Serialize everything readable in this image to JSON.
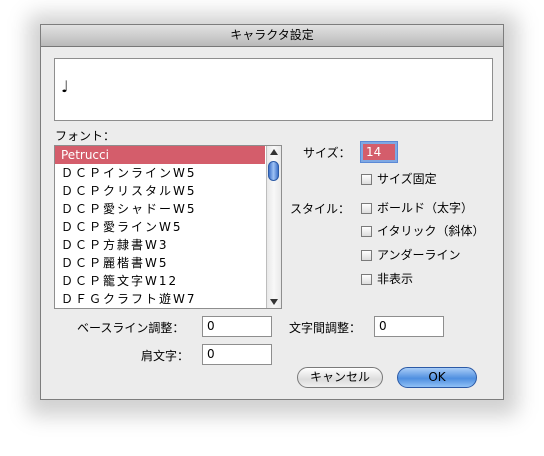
{
  "dialog": {
    "title": "キャラクタ設定",
    "preview_text": "♩"
  },
  "font_section": {
    "label": "フォント：",
    "items": [
      "Petrucci",
      "ＤＣＰインラインW5",
      "ＤＣＰクリスタルW5",
      "ＤＣＰ愛シャドーW5",
      "ＤＣＰ愛ラインW5",
      "ＤＣＰ方隷書W3",
      "ＤＣＰ麗楷書W5",
      "ＤＣＰ籠文字W12",
      "ＤＦＧクラフト遊W7"
    ],
    "selected_index": 0
  },
  "size": {
    "label": "サイズ：",
    "value": "14",
    "fixed_label": "サイズ固定"
  },
  "style": {
    "label": "スタイル：",
    "options": [
      "ボールド（太字）",
      "イタリック（斜体）",
      "アンダーライン",
      "非表示"
    ]
  },
  "fields": {
    "baseline_label": "ベースライン調整：",
    "baseline_value": "0",
    "tracking_label": "文字間調整：",
    "tracking_value": "0",
    "superscript_label": "肩文字：",
    "superscript_value": "0"
  },
  "buttons": {
    "cancel": "キャンセル",
    "ok": "OK"
  },
  "colors": {
    "selection": "#d45d6b",
    "ok_button": "#4f8fe0"
  }
}
